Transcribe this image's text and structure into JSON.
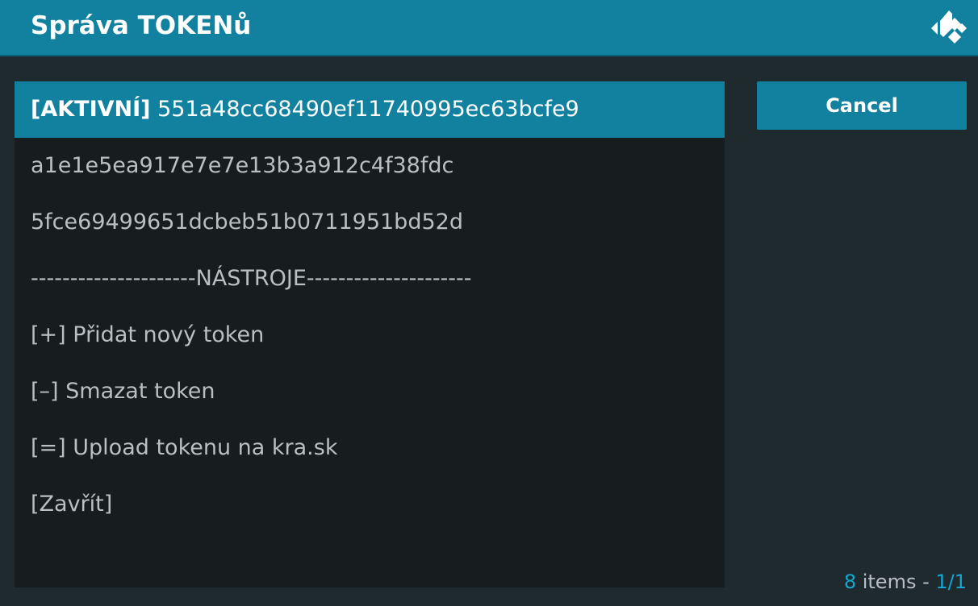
{
  "header": {
    "title": "Správa TOKENů",
    "logo_icon": "kodi-logo-icon"
  },
  "list": {
    "items": [
      {
        "label": "[AKTIVNÍ] 551a48cc68490ef11740995ec63bcfe9",
        "selected": true
      },
      {
        "label": "a1e1e5ea917e7e7e13b3a912c4f38fdc",
        "selected": false
      },
      {
        "label": "5fce69499651dcbeb51b0711951bd52d",
        "selected": false
      },
      {
        "label": "---------------------NÁSTROJE---------------------",
        "selected": false
      },
      {
        "label": "[+] Přidat nový token",
        "selected": false
      },
      {
        "label": "[–] Smazat token",
        "selected": false
      },
      {
        "label": "[=] Upload tokenu na kra.sk",
        "selected": false
      },
      {
        "label": "[Zavřít]",
        "selected": false
      }
    ]
  },
  "side": {
    "cancel_label": "Cancel"
  },
  "footer": {
    "count": "8",
    "items_text": " items - ",
    "page": "1/1"
  },
  "colors": {
    "accent": "#12819f",
    "highlight_text": "#12a6d2",
    "background": "#171c1f"
  }
}
